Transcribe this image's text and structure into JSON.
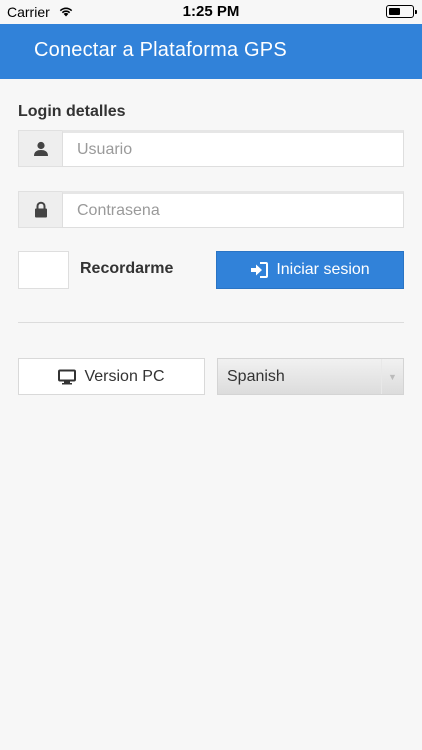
{
  "status_bar": {
    "carrier": "Carrier",
    "time": "1:25 PM"
  },
  "header": {
    "title": "Conectar a Plataforma GPS"
  },
  "login": {
    "section_title": "Login detalles",
    "username_placeholder": "Usuario",
    "username_icon": "user-icon",
    "password_placeholder": "Contrasena",
    "password_icon": "lock-icon",
    "remember_label": "Recordarme",
    "remember_checked": false,
    "submit_label": "Iniciar sesion",
    "submit_icon": "sign-in-icon"
  },
  "footer_actions": {
    "pc_version_label": "Version PC",
    "pc_version_icon": "desktop-icon",
    "language_selected": "Spanish"
  },
  "colors": {
    "accent": "#3182d9",
    "background": "#f7f7f7"
  }
}
